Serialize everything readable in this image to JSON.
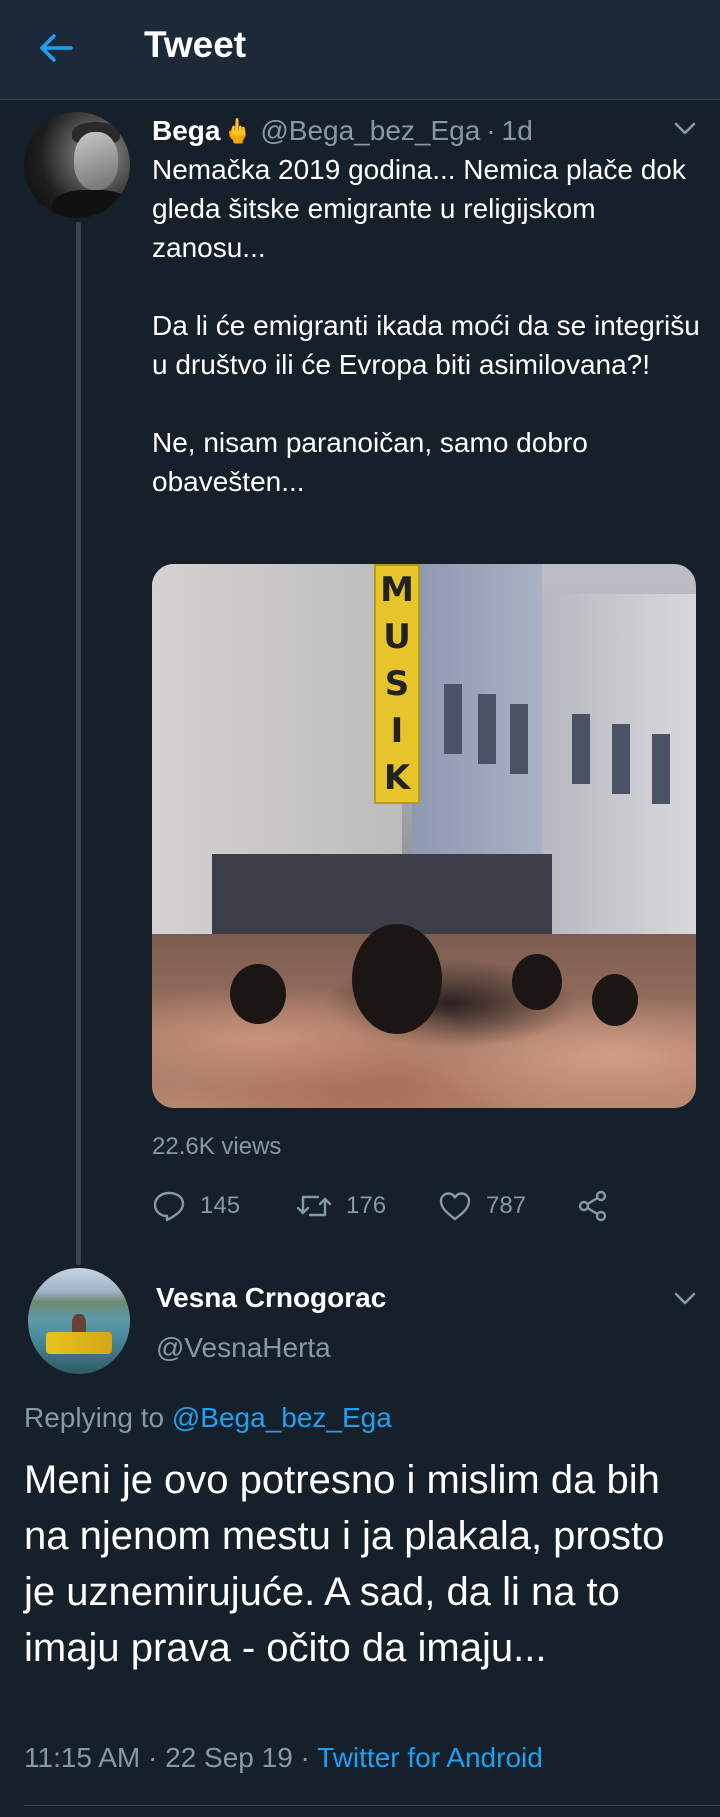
{
  "header": {
    "title": "Tweet",
    "back_icon": "arrow-left-icon"
  },
  "colors": {
    "background": "#15202b",
    "header_background": "#1c2938",
    "accent": "#1da1f2",
    "secondary_text": "#8899a6",
    "divider": "#38444d"
  },
  "tweet": {
    "author_name": "Bega",
    "author_emoji": "🖕",
    "author_handle": "@Bega_bez_Ega",
    "separator": "·",
    "time_ago": "1d",
    "text": "Nemačka 2019 godina... Nemica plače dok gleda šitske emigrante u religijskom zanosu...\n\nDa li će emigranti ikada moći da se integrišu u društvo ili će Evropa biti asimilovana?!\n\nNe, nisam paranoičan, samo dobro obavešten...",
    "media_sign_letters": [
      "M",
      "U",
      "S",
      "I",
      "K"
    ],
    "views": "22.6K views",
    "reply_count": "145",
    "retweet_count": "176",
    "like_count": "787"
  },
  "reply": {
    "author_name": "Vesna Crnogorac",
    "author_handle": "@VesnaHerta",
    "replying_prefix": "Replying to ",
    "replying_to": "@Bega_bez_Ega",
    "text": "Meni je ovo potresno i mislim da bih na njenom mestu i ja plakala, prosto je uznemirujuće. A sad, da li na to imaju prava - očito da imaju...",
    "timestamp": "11:15 AM · 22 Sep 19 · ",
    "source": "Twitter for Android"
  }
}
